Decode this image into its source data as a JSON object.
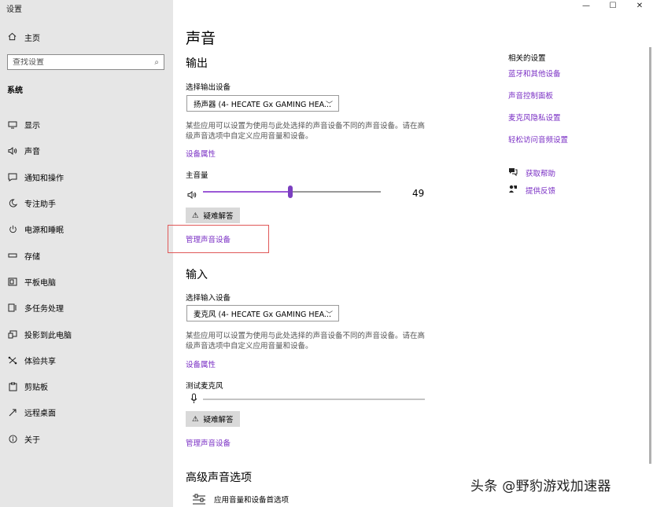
{
  "window": {
    "title": "设置",
    "controls": [
      "—",
      "☐",
      "✕"
    ]
  },
  "sidebar": {
    "home_label": "主页",
    "search_placeholder": "查找设置",
    "section": "系统",
    "items": [
      {
        "label": "显示",
        "icon": "monitor-icon"
      },
      {
        "label": "声音",
        "icon": "speaker-icon"
      },
      {
        "label": "通知和操作",
        "icon": "notification-icon"
      },
      {
        "label": "专注助手",
        "icon": "moon-icon"
      },
      {
        "label": "电源和睡眠",
        "icon": "power-icon"
      },
      {
        "label": "存储",
        "icon": "storage-icon"
      },
      {
        "label": "平板电脑",
        "icon": "tablet-icon"
      },
      {
        "label": "多任务处理",
        "icon": "multitask-icon"
      },
      {
        "label": "投影到此电脑",
        "icon": "projection-icon"
      },
      {
        "label": "体验共享",
        "icon": "share-icon"
      },
      {
        "label": "剪贴板",
        "icon": "clipboard-icon"
      },
      {
        "label": "远程桌面",
        "icon": "remote-desktop-icon"
      },
      {
        "label": "关于",
        "icon": "info-icon"
      }
    ]
  },
  "main": {
    "title": "声音",
    "output": {
      "heading": "输出",
      "device_label": "选择输出设备",
      "device_value": "扬声器 (4- HECATE Gx GAMING HEA...",
      "desc_line1": "某些应用可以设置为使用与此处选择的声音设备不同的声音设备。请在高",
      "desc_line2": "级声音选项中自定义应用音量和设备。",
      "properties_link": "设备属性",
      "volume_label": "主音量",
      "volume_value": "49",
      "volume": 49,
      "troubleshoot": "疑难解答",
      "manage_link": "管理声音设备"
    },
    "input": {
      "heading": "输入",
      "device_label": "选择输入设备",
      "device_value": "麦克风 (4- HECATE Gx GAMING HEA...",
      "desc_line1": "某些应用可以设置为使用与此处选择的声音设备不同的声音设备。请在高",
      "desc_line2": "级声音选项中自定义应用音量和设备。",
      "properties_link": "设备属性",
      "test_label": "测试麦克风",
      "troubleshoot": "疑难解答",
      "manage_link": "管理声音设备"
    },
    "advanced": {
      "heading": "高级声音选项",
      "item_label": "应用音量和设备首选项"
    }
  },
  "related": {
    "title": "相关的设置",
    "links": [
      "蓝牙和其他设备",
      "声音控制面板",
      "麦克风隐私设置",
      "轻松访问音频设置"
    ],
    "help": "获取帮助",
    "feedback": "提供反馈"
  },
  "watermark": "头条 @野豹游戏加速器",
  "colors": {
    "accent": "#7a2fc4",
    "slider": "#9b59d6",
    "highlight": "#e05858",
    "sidebar": "#e6e6e6"
  }
}
